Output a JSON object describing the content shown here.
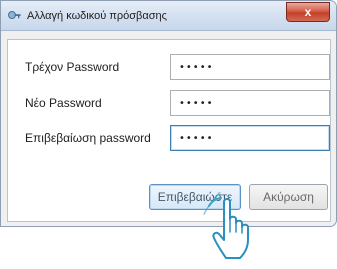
{
  "window": {
    "title": "Αλλαγή κωδικού πρόσβασης",
    "close_label": "x",
    "icon": "key-app-icon"
  },
  "form": {
    "current_label": "Τρέχον Password",
    "current_value": "•••••",
    "new_label": "Νέο Password",
    "new_value": "•••••",
    "confirm_label": "Επιβεβαίωση password",
    "confirm_value": "•••••"
  },
  "buttons": {
    "confirm_label": "Επιβεβαιώστε",
    "cancel_label": "Ακύρωση"
  },
  "cursor": {
    "icon": "hand-pointer-icon"
  },
  "colors": {
    "title_gradient": "#d3e0f0",
    "close_red": "#c4402a",
    "focus_border": "#3c7fb1"
  }
}
